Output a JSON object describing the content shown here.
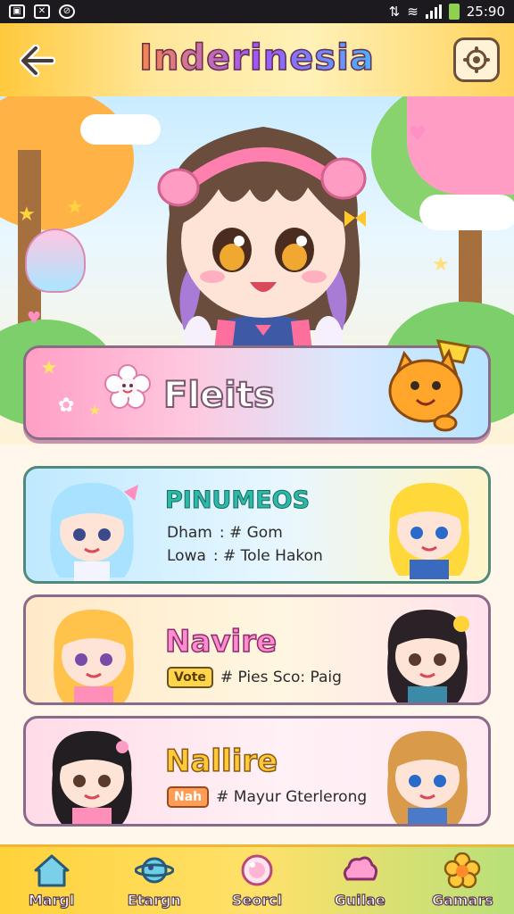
{
  "status_bar": {
    "time": "25:90"
  },
  "header": {
    "app_title": "Inderinesia"
  },
  "featured": {
    "title": "Fleits"
  },
  "cards": [
    {
      "title": "PINUMEOS",
      "line1_label": "Dham",
      "line1_value": ": # Gom",
      "line2_label": "Lowa",
      "line2_value": ": # Tole Hakon"
    },
    {
      "title": "Navire",
      "tag": "Vote",
      "value": "# Pies Sco: Paig"
    },
    {
      "title": "Nallire",
      "tag": "Nah",
      "value": "# Mayur Gterlerong"
    }
  ],
  "bottom_nav": [
    {
      "label": "Margl",
      "icon": "home-icon"
    },
    {
      "label": "Etargn",
      "icon": "planet-icon"
    },
    {
      "label": "Seorcl",
      "icon": "orb-icon"
    },
    {
      "label": "Guilae",
      "icon": "cloud-icon"
    },
    {
      "label": "Gamars",
      "icon": "flower-icon"
    }
  ]
}
